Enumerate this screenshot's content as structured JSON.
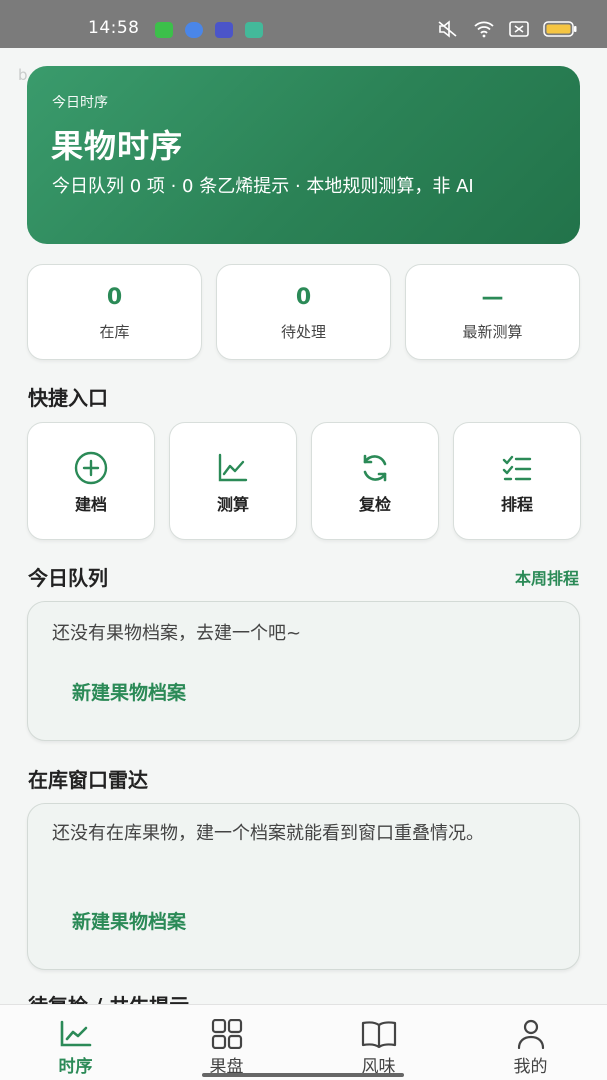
{
  "status_bar": {
    "time": "14:58"
  },
  "hero": {
    "kicker": "今日时序",
    "title": "果物时序",
    "subtitle": "今日队列 0 项 · 0 条乙烯提示 · 本地规则测算，非 AI"
  },
  "stats": [
    {
      "value": "0",
      "label": "在库"
    },
    {
      "value": "0",
      "label": "待处理"
    },
    {
      "value": "—",
      "label": "最新测算"
    }
  ],
  "quick": {
    "title": "快捷入口",
    "items": [
      {
        "label": "建档",
        "icon": "add-circle-icon"
      },
      {
        "label": "测算",
        "icon": "line-chart-icon"
      },
      {
        "label": "复检",
        "icon": "refresh-icon"
      },
      {
        "label": "排程",
        "icon": "checklist-icon"
      }
    ]
  },
  "queue": {
    "title": "今日队列",
    "link": "本周排程",
    "empty_text": "还没有果物档案，去建一个吧~",
    "action": "新建果物档案"
  },
  "radar": {
    "title": "在库窗口雷达",
    "empty_text": "还没有在库果物，建一个档案就能看到窗口重叠情况。",
    "action": "新建果物档案"
  },
  "next_section": {
    "title": "待复检 / 共生提示"
  },
  "tabs": [
    {
      "label": "时序",
      "icon": "line-chart-icon",
      "active": true
    },
    {
      "label": "果盘",
      "icon": "grid-icon",
      "active": false
    },
    {
      "label": "风味",
      "icon": "book-icon",
      "active": false
    },
    {
      "label": "我的",
      "icon": "user-icon",
      "active": false
    }
  ],
  "colors": {
    "accent": "#2b8a57",
    "hero_gradient_start": "#3a9b6c",
    "hero_gradient_end": "#22734a"
  }
}
